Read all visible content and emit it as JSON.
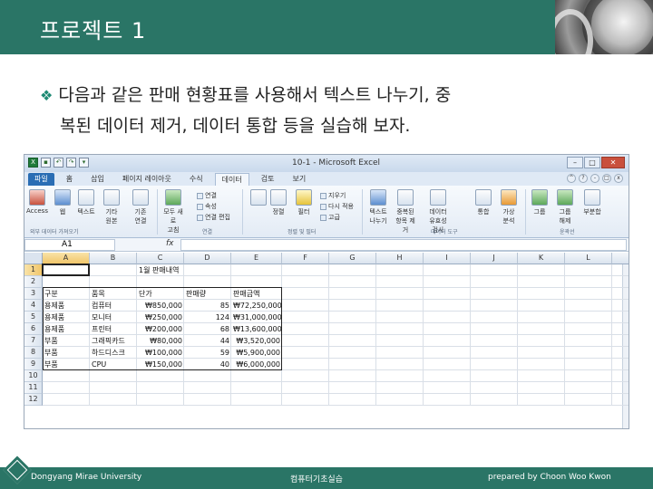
{
  "slide": {
    "title": "프로젝트 1",
    "bullet_line1": "다음과 같은 판매 현황표를 사용해서 텍스트 나누기, 중",
    "bullet_line2": "복된 데이터 제거, 데이터 통합 등을 실습해 보자."
  },
  "excel": {
    "window_title": "10-1 - Microsoft Excel",
    "tabs": [
      "파일",
      "홈",
      "삽입",
      "페이지 레이아웃",
      "수식",
      "데이터",
      "검토",
      "보기"
    ],
    "active_tab": "데이터",
    "ribbon": {
      "access": "Access",
      "web": "웹",
      "text": "텍스트",
      "other": "기타",
      "other_sub": "원본",
      "existing": "기존",
      "existing_sub": "연결",
      "refresh_all": "모두 새로",
      "refresh_all_sub": "고침",
      "connections": "연결",
      "properties": "속성",
      "edit_links": "연결 편집",
      "sort": "정렬",
      "filter": "필터",
      "clear": "지우기",
      "reapply": "다시 적용",
      "advanced": "고급",
      "text_to_columns": "텍스트",
      "text_to_columns_sub": "나누기",
      "remove_dup": "중복된",
      "remove_dup_sub": "항목 제거",
      "validation": "데이터",
      "validation_sub": "유효성 검사",
      "consolidate": "통합",
      "what_if": "가상",
      "what_if_sub": "분석",
      "group": "그룹",
      "ungroup": "그룹",
      "ungroup_sub": "해제",
      "subtotal": "부분합",
      "group_labels": {
        "get_external": "외부 데이터 가져오기",
        "connections": "연결",
        "sort_filter": "정렬 및 필터",
        "data_tools": "데이터 도구",
        "outline": "윤곽선"
      }
    },
    "name_box": "A1",
    "fx": "fx",
    "columns": [
      "A",
      "B",
      "C",
      "D",
      "E",
      "F",
      "G",
      "H",
      "I",
      "J",
      "K",
      "L",
      "M"
    ],
    "rows": [
      "1",
      "2",
      "3",
      "4",
      "5",
      "6",
      "7",
      "8",
      "9",
      "10",
      "11",
      "12"
    ],
    "sheet_title": "1월 판매내역",
    "table_headers": [
      "구분",
      "품목",
      "단가",
      "판매량",
      "판매금액"
    ],
    "table_rows": [
      [
        "용제품",
        "컴퓨터",
        "₩850,000",
        "85",
        "₩72,250,000"
      ],
      [
        "용제품",
        "모니터",
        "₩250,000",
        "124",
        "₩31,000,000"
      ],
      [
        "용제품",
        "프린터",
        "₩200,000",
        "68",
        "₩13,600,000"
      ],
      [
        "부품",
        "그래픽카드",
        "₩80,000",
        "44",
        "₩3,520,000"
      ],
      [
        "부품",
        "하드디스크",
        "₩100,000",
        "59",
        "₩5,900,000"
      ],
      [
        "부품",
        "CPU",
        "₩150,000",
        "40",
        "₩6,000,000"
      ]
    ]
  },
  "footer": {
    "left": "Dongyang Mirae University",
    "center": "컴퓨터기초실습",
    "right": "prepared by Choon Woo Kwon"
  },
  "colors": {
    "theme": "#2a7566",
    "bullet": "#1e8a73"
  }
}
